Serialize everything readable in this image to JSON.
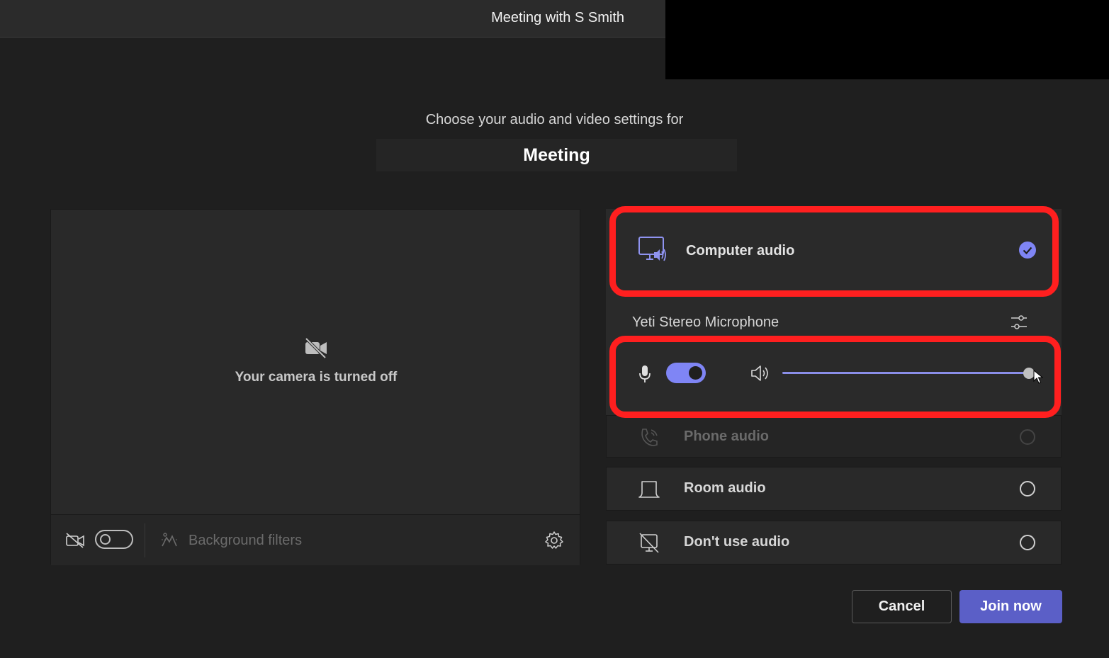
{
  "window": {
    "title": "Meeting with S Smith"
  },
  "header": {
    "subtitle": "Choose your audio and video settings for",
    "meeting_name": "Meeting"
  },
  "video": {
    "camera_status": "Your camera is turned off",
    "camera_toggle_on": false,
    "background_filters_label": "Background filters"
  },
  "audio": {
    "options": [
      {
        "label": "Computer audio",
        "selected": true,
        "icon": "computer-speaker-icon"
      },
      {
        "label": "Phone audio",
        "selected": false,
        "icon": "phone-icon"
      },
      {
        "label": "Room audio",
        "selected": false,
        "icon": "room-device-icon"
      },
      {
        "label": "Don't use audio",
        "selected": false,
        "icon": "no-audio-icon"
      }
    ],
    "microphone_name": "Yeti Stereo Microphone",
    "mic_toggle_on": true,
    "speaker_volume_fraction": 0.99
  },
  "colors": {
    "accent": "#7f85f5",
    "primary_button": "#5b5fc7",
    "highlight": "#ff1f1f"
  },
  "actions": {
    "cancel_label": "Cancel",
    "join_label": "Join now"
  }
}
